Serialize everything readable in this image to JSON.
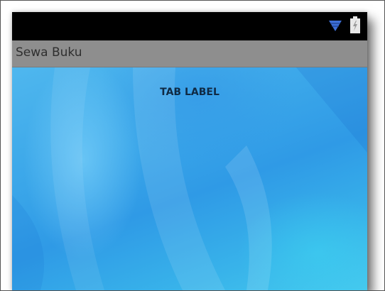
{
  "status_bar": {
    "icons": [
      "wifi-icon",
      "battery-icon"
    ],
    "background": "#000000"
  },
  "action_bar": {
    "title": "Sewa Buku",
    "background": "#8e8e8e"
  },
  "content": {
    "tab_label": "TAB LABEL",
    "background_accent": "#3aa6e9"
  }
}
